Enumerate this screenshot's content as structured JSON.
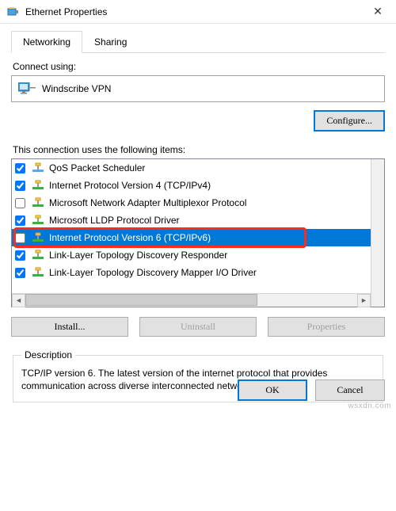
{
  "window": {
    "title": "Ethernet Properties",
    "close_label": "✕"
  },
  "tabs": {
    "networking": "Networking",
    "sharing": "Sharing"
  },
  "connect": {
    "label": "Connect using:",
    "adapter": "Windscribe VPN",
    "configure": "Configure..."
  },
  "items": {
    "label": "This connection uses the following items:",
    "list": [
      {
        "checked": true,
        "label": "QoS Packet Scheduler",
        "iconColor": "#5aa6e6",
        "selected": false
      },
      {
        "checked": true,
        "label": "Internet Protocol Version 4 (TCP/IPv4)",
        "iconColor": "#3cb043",
        "selected": false
      },
      {
        "checked": false,
        "label": "Microsoft Network Adapter Multiplexor Protocol",
        "iconColor": "#3cb043",
        "selected": false
      },
      {
        "checked": true,
        "label": "Microsoft LLDP Protocol Driver",
        "iconColor": "#3cb043",
        "selected": false
      },
      {
        "checked": false,
        "label": "Internet Protocol Version 6 (TCP/IPv6)",
        "iconColor": "#3cb043",
        "selected": true
      },
      {
        "checked": true,
        "label": "Link-Layer Topology Discovery Responder",
        "iconColor": "#3cb043",
        "selected": false
      },
      {
        "checked": true,
        "label": "Link-Layer Topology Discovery Mapper I/O Driver",
        "iconColor": "#3cb043",
        "selected": false
      }
    ]
  },
  "buttons": {
    "install": "Install...",
    "uninstall": "Uninstall",
    "properties": "Properties"
  },
  "description": {
    "legend": "Description",
    "text": "TCP/IP version 6. The latest version of the internet protocol that provides communication across diverse interconnected networks."
  },
  "footer": {
    "ok": "OK",
    "cancel": "Cancel"
  },
  "watermark": "wsxdn.com"
}
